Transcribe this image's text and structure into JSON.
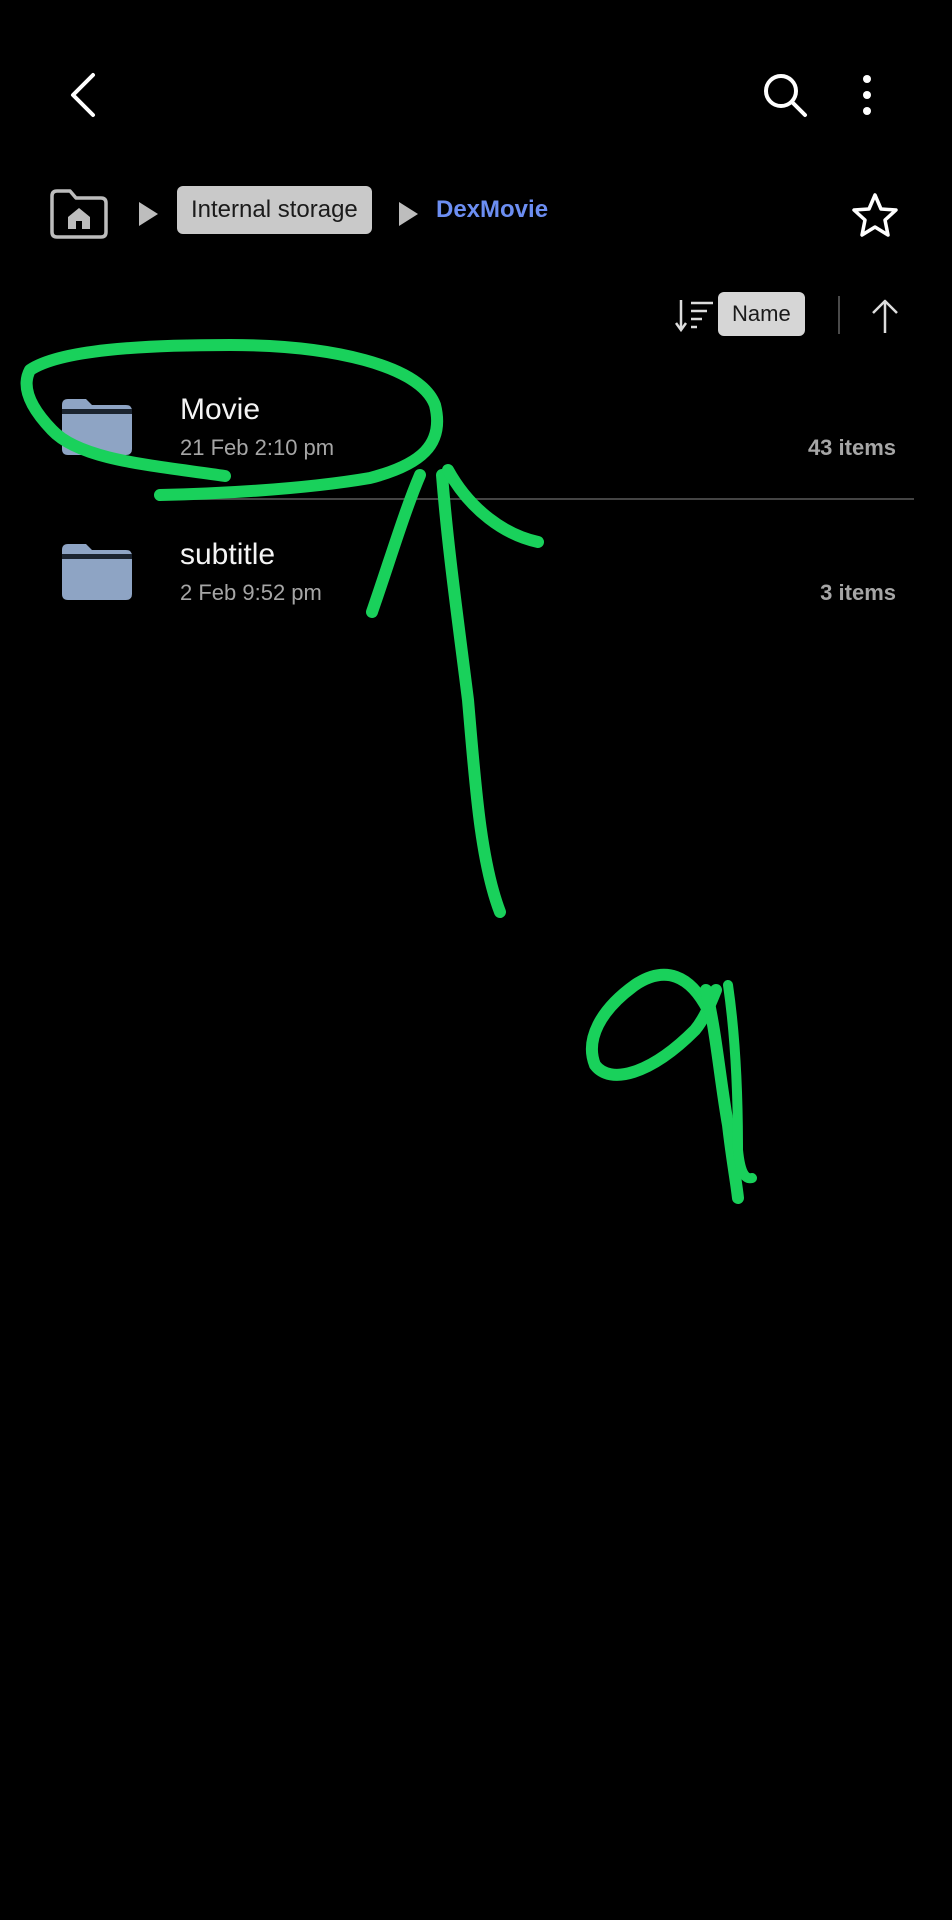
{
  "appbar": {
    "back_icon": "chevron-left-icon",
    "search_icon": "search-icon",
    "more_icon": "more-vertical-icon"
  },
  "breadcrumb": {
    "home_icon": "home-folder-icon",
    "items": [
      {
        "label": "Internal storage"
      },
      {
        "label": "DexMovie"
      }
    ],
    "favorite_icon": "star-outline-icon"
  },
  "sort": {
    "icon": "sort-icon",
    "label": "Name",
    "direction_icon": "arrow-up-icon"
  },
  "files": [
    {
      "name": "Movie",
      "date": "21 Feb 2:10 pm",
      "count": "43 items",
      "icon": "folder-icon"
    },
    {
      "name": "subtitle",
      "date": "2 Feb 9:52 pm",
      "count": "3 items",
      "icon": "folder-icon"
    }
  ],
  "colors": {
    "background": "#000000",
    "accent": "#6c8ef2",
    "folder": "#8ea4c4",
    "annotation": "#19d15b"
  }
}
